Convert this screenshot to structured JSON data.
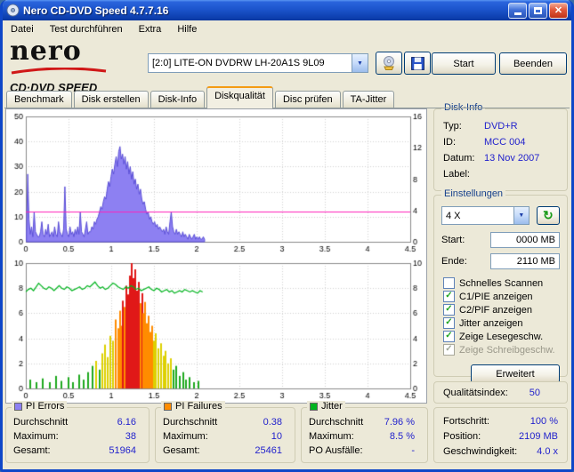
{
  "colors": {
    "value_text": "#2222cc",
    "group_title": "#16408c",
    "pi_errors": "#8d80f2",
    "pi_failures": "#ff8c00",
    "jitter": "#00b41e",
    "threshold_line": "#ff22bb"
  },
  "window": {
    "title": "Nero CD-DVD Speed 4.7.7.16"
  },
  "menu": {
    "items": [
      "Datei",
      "Test durchführen",
      "Extra",
      "Hilfe"
    ]
  },
  "logo": {
    "line1": "nero",
    "line2": "CD·DVD SPEED"
  },
  "toolbar": {
    "drive": "[2:0]  LITE-ON DVDRW LH-20A1S 9L09",
    "start": "Start",
    "beenden": "Beenden"
  },
  "tabs": {
    "items": [
      "Benchmark",
      "Disk erstellen",
      "Disk-Info",
      "Diskqualität",
      "Disc prüfen",
      "TA-Jitter"
    ],
    "active": "Diskqualität"
  },
  "disk_info": {
    "title": "Disk-Info",
    "rows": [
      {
        "label": "Typ:",
        "value": "DVD+R"
      },
      {
        "label": "ID:",
        "value": "MCC 004"
      },
      {
        "label": "Datum:",
        "value": "13 Nov 2007"
      },
      {
        "label": "Label:",
        "value": ""
      }
    ]
  },
  "settings": {
    "title": "Einstellungen",
    "speed": "4 X",
    "start_label": "Start:",
    "start_value": "0000 MB",
    "end_label": "Ende:",
    "end_value": "2110 MB",
    "checkboxes": [
      {
        "label": "Schnelles Scannen",
        "checked": false,
        "disabled": false
      },
      {
        "label": "C1/PIE anzeigen",
        "checked": true,
        "disabled": false
      },
      {
        "label": "C2/PIF anzeigen",
        "checked": true,
        "disabled": false
      },
      {
        "label": "Jitter anzeigen",
        "checked": true,
        "disabled": false
      },
      {
        "label": "Zeige Lesegeschw.",
        "checked": true,
        "disabled": false
      },
      {
        "label": "Zeige Schreibgeschw.",
        "checked": true,
        "disabled": true
      }
    ],
    "erweitert": "Erweitert"
  },
  "quality": {
    "label": "Qualitätsindex:",
    "value": "50"
  },
  "progress": {
    "rows": [
      {
        "label": "Fortschritt:",
        "value": "100 %"
      },
      {
        "label": "Position:",
        "value": "2109 MB"
      },
      {
        "label": "Geschwindigkeit:",
        "value": "4.0 x"
      }
    ]
  },
  "stats": {
    "pi_errors": {
      "title": "PI Errors",
      "color": "#8d80f2",
      "rows": [
        {
          "label": "Durchschnitt",
          "value": "6.16"
        },
        {
          "label": "Maximum:",
          "value": "38"
        },
        {
          "label": "Gesamt:",
          "value": "51964"
        }
      ]
    },
    "pi_failures": {
      "title": "PI Failures",
      "color": "#ff8c00",
      "rows": [
        {
          "label": "Durchschnitt",
          "value": "0.38"
        },
        {
          "label": "Maximum:",
          "value": "10"
        },
        {
          "label": "Gesamt:",
          "value": "25461"
        }
      ]
    },
    "jitter": {
      "title": "Jitter",
      "color": "#00b41e",
      "rows": [
        {
          "label": "Durchschnitt",
          "value": "7.96 %"
        },
        {
          "label": "Maximum:",
          "value": "8.5 %"
        },
        {
          "label": "PO Ausfälle:",
          "value": "-"
        }
      ]
    }
  },
  "chart_data": [
    {
      "type": "area",
      "title": "PI Errors over disc position (GB)",
      "x_range": [
        0,
        4.5
      ],
      "x_ticks": [
        0,
        0.5,
        1,
        1.5,
        2,
        2.5,
        3,
        3.5,
        4,
        4.5
      ],
      "x_tick_labels": [
        "0",
        "0.5",
        "1",
        "1.5",
        "2",
        "2.5",
        "3",
        "3.5",
        "4",
        "4.5"
      ],
      "y_left": {
        "range": [
          0,
          50
        ],
        "ticks": [
          0,
          10,
          20,
          30,
          40,
          50
        ]
      },
      "y_right": {
        "range": [
          0,
          16
        ],
        "ticks": [
          0,
          4,
          8,
          12,
          16
        ]
      },
      "series": [
        {
          "name": "PI Errors",
          "type": "area",
          "color": "#5b4fd8",
          "fill": "#8d80f2",
          "x0": 0.0075,
          "dx": 0.015,
          "values": [
            4,
            27,
            9,
            3,
            6,
            2,
            12,
            4,
            3,
            2,
            2,
            4,
            8,
            3,
            2,
            5,
            3,
            7,
            2,
            3,
            4,
            2,
            6,
            3,
            2,
            8,
            4,
            3,
            2,
            5,
            22,
            5,
            3,
            2,
            6,
            3,
            4,
            2,
            5,
            3,
            6,
            3,
            12,
            4,
            3,
            2,
            5,
            8,
            3,
            4,
            4,
            6,
            5,
            8,
            7,
            9,
            10,
            12,
            14,
            13,
            16,
            18,
            17,
            21,
            24,
            22,
            26,
            29,
            27,
            31,
            34,
            30,
            36,
            38,
            33,
            35,
            31,
            34,
            29,
            32,
            27,
            30,
            25,
            28,
            23,
            25,
            21,
            23,
            19,
            21,
            17,
            15,
            16,
            13,
            11,
            12,
            9,
            10,
            8,
            7,
            8,
            6,
            7,
            5,
            6,
            5,
            4,
            5,
            3,
            6,
            4,
            3,
            8,
            12,
            6,
            4,
            3,
            5,
            3,
            4,
            3,
            2,
            4,
            2,
            3,
            2,
            1,
            3,
            2,
            1,
            2,
            3,
            1,
            2,
            1,
            2,
            1,
            1,
            2,
            1
          ]
        },
        {
          "name": "threshold",
          "type": "hline",
          "y": 12,
          "color": "#ff22bb"
        }
      ]
    },
    {
      "type": "bar",
      "title": "PI Failures (bars) and Jitter (line) over disc position (GB)",
      "x_range": [
        0,
        4.5
      ],
      "x_ticks": [
        0,
        0.5,
        1,
        1.5,
        2,
        2.5,
        3,
        3.5,
        4,
        4.5
      ],
      "x_tick_labels": [
        "0",
        "0.5",
        "1",
        "1.5",
        "2",
        "2.5",
        "3",
        "3.5",
        "4",
        "4.5"
      ],
      "y_left": {
        "range": [
          0,
          10
        ],
        "ticks": [
          0,
          2,
          4,
          6,
          8,
          10
        ]
      },
      "y_right": {
        "range": [
          0,
          10
        ],
        "ticks": [
          0,
          2,
          4,
          6,
          8,
          10
        ]
      },
      "series": [
        {
          "name": "PI Failures",
          "type": "bars",
          "color_thresholds": [
            [
              2,
              "#1faa1f"
            ],
            [
              4.5,
              "#ddd000"
            ],
            [
              7,
              "#ff8c00"
            ],
            [
              999,
              "#e01818"
            ]
          ],
          "points": [
            [
              0.05,
              0.7
            ],
            [
              0.12,
              0.5
            ],
            [
              0.2,
              0.8
            ],
            [
              0.28,
              0.5
            ],
            [
              0.35,
              1.0
            ],
            [
              0.42,
              0.6
            ],
            [
              0.5,
              0.9
            ],
            [
              0.55,
              0.5
            ],
            [
              0.62,
              1.1
            ],
            [
              0.68,
              0.7
            ],
            [
              0.73,
              1.3
            ],
            [
              0.78,
              1.8
            ],
            [
              0.82,
              2.2
            ],
            [
              0.86,
              1.5
            ],
            [
              0.9,
              2.8
            ],
            [
              0.93,
              3.5
            ],
            [
              0.96,
              2.5
            ],
            [
              0.99,
              4.2
            ],
            [
              1.02,
              3.8
            ],
            [
              1.05,
              5.5
            ],
            [
              1.08,
              4.8
            ],
            [
              1.1,
              6.2
            ],
            [
              1.12,
              5.0
            ],
            [
              1.14,
              7.0
            ],
            [
              1.16,
              6.5
            ],
            [
              1.18,
              8.2
            ],
            [
              1.2,
              7.5
            ],
            [
              1.22,
              9.0
            ],
            [
              1.24,
              10.0
            ],
            [
              1.26,
              8.8
            ],
            [
              1.28,
              9.5
            ],
            [
              1.3,
              7.8
            ],
            [
              1.32,
              8.5
            ],
            [
              1.34,
              6.8
            ],
            [
              1.36,
              7.6
            ],
            [
              1.38,
              6.0
            ],
            [
              1.4,
              6.9
            ],
            [
              1.42,
              5.2
            ],
            [
              1.44,
              5.8
            ],
            [
              1.46,
              4.5
            ],
            [
              1.48,
              5.0
            ],
            [
              1.5,
              3.8
            ],
            [
              1.52,
              4.4
            ],
            [
              1.55,
              3.2
            ],
            [
              1.58,
              3.6
            ],
            [
              1.61,
              2.6
            ],
            [
              1.64,
              3.0
            ],
            [
              1.67,
              2.0
            ],
            [
              1.7,
              2.4
            ],
            [
              1.73,
              1.5
            ],
            [
              1.76,
              1.8
            ],
            [
              1.8,
              1.0
            ],
            [
              1.84,
              1.3
            ],
            [
              1.88,
              0.7
            ],
            [
              1.92,
              0.9
            ],
            [
              1.97,
              0.5
            ],
            [
              2.02,
              0.6
            ]
          ]
        },
        {
          "name": "Jitter",
          "type": "line",
          "color": "#00b41e",
          "x0": 0,
          "dx": 0.03,
          "values": [
            7.7,
            7.9,
            8.0,
            7.8,
            8.1,
            8.4,
            8.2,
            8.0,
            7.9,
            8.1,
            8.0,
            7.8,
            8.0,
            8.2,
            8.0,
            7.9,
            8.1,
            8.0,
            7.8,
            7.9,
            8.0,
            8.1,
            7.9,
            8.0,
            8.2,
            8.1,
            8.3,
            8.5,
            8.2,
            8.0,
            8.1,
            7.9,
            8.0,
            8.2,
            8.4,
            8.3,
            8.1,
            8.0,
            7.9,
            8.1,
            8.0,
            8.2,
            8.1,
            7.9,
            8.0,
            7.8,
            7.9,
            8.0,
            8.1,
            7.9,
            7.8,
            8.0,
            7.9,
            7.7,
            7.8,
            7.9,
            7.7,
            7.8,
            7.6,
            7.7,
            7.8,
            7.7,
            7.9,
            7.8,
            7.7,
            7.8,
            7.7,
            7.6,
            7.8,
            7.7
          ]
        }
      ]
    }
  ]
}
